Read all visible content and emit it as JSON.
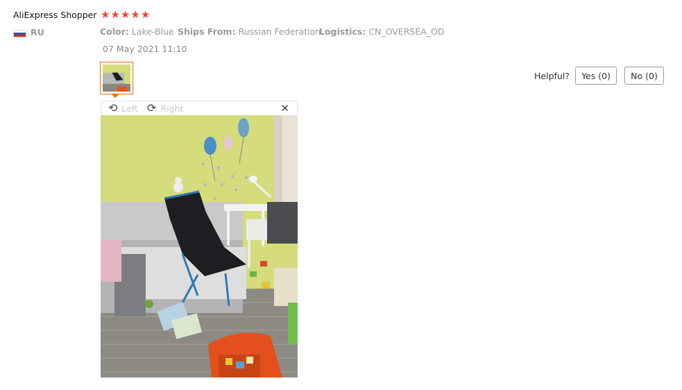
{
  "reviewer": {
    "name": "AliExpress Shopper",
    "rating": 5,
    "country": "RU"
  },
  "stars": [
    "★",
    "★",
    "★",
    "★",
    "★"
  ],
  "meta": {
    "color_label": "Color:",
    "color_value": "Lake-Blue",
    "ships_label": "Ships From:",
    "ships_value": "Russian Federation",
    "logistics_label": "Logistics:",
    "logistics_value": "CN_OVERSEA_OD"
  },
  "date": "07 May 2021 11:10",
  "helpful": {
    "label": "Helpful?",
    "yes": "Yes (0)",
    "no": "No (0)"
  },
  "viewer": {
    "left_label": "Left",
    "right_label": "Right",
    "close_glyph": "✕",
    "rotate_left_glyph": "⟲",
    "rotate_right_glyph": "⟳"
  },
  "colors": {
    "accent": "#e46c15",
    "star": "#f44336",
    "muted": "#999999"
  }
}
